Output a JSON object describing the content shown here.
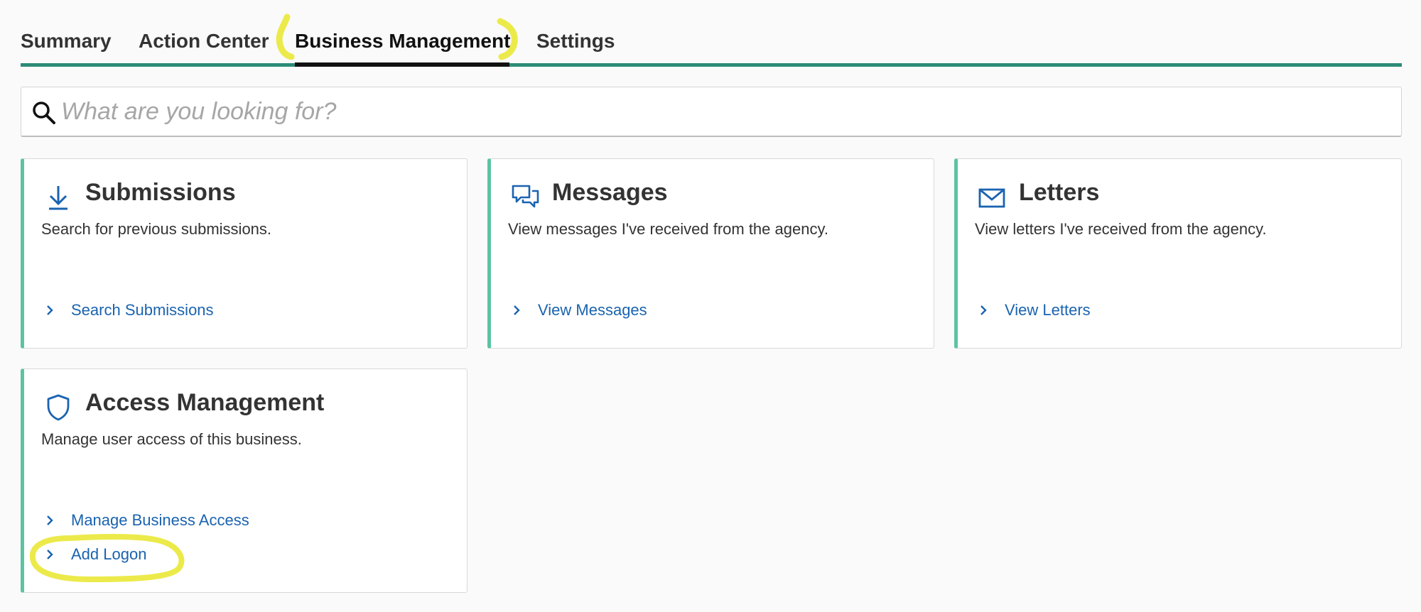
{
  "tabs": [
    {
      "label": "Summary",
      "active": false
    },
    {
      "label": "Action Center",
      "active": false
    },
    {
      "label": "Business Management",
      "active": true
    },
    {
      "label": "Settings",
      "active": false
    }
  ],
  "search": {
    "placeholder": "What are you looking for?",
    "icon": "search-icon"
  },
  "cards": [
    {
      "title": "Submissions",
      "description": "Search for previous submissions.",
      "icon": "download-icon",
      "links": [
        "Search Submissions"
      ]
    },
    {
      "title": "Messages",
      "description": "View messages I've received from the agency.",
      "icon": "chat-bubbles-icon",
      "links": [
        "View Messages"
      ]
    },
    {
      "title": "Letters",
      "description": "View letters I've received from the agency.",
      "icon": "envelope-icon",
      "links": [
        "View Letters"
      ]
    },
    {
      "title": "Access Management",
      "description": "Manage user access of this business.",
      "icon": "shield-icon",
      "links": [
        "Manage Business Access",
        "Add Logon"
      ]
    }
  ],
  "colors": {
    "accent_green": "#2c8c77",
    "card_border_green": "#5cc3a3",
    "link_blue": "#1a63b0",
    "highlight_yellow": "#ecea4a"
  }
}
